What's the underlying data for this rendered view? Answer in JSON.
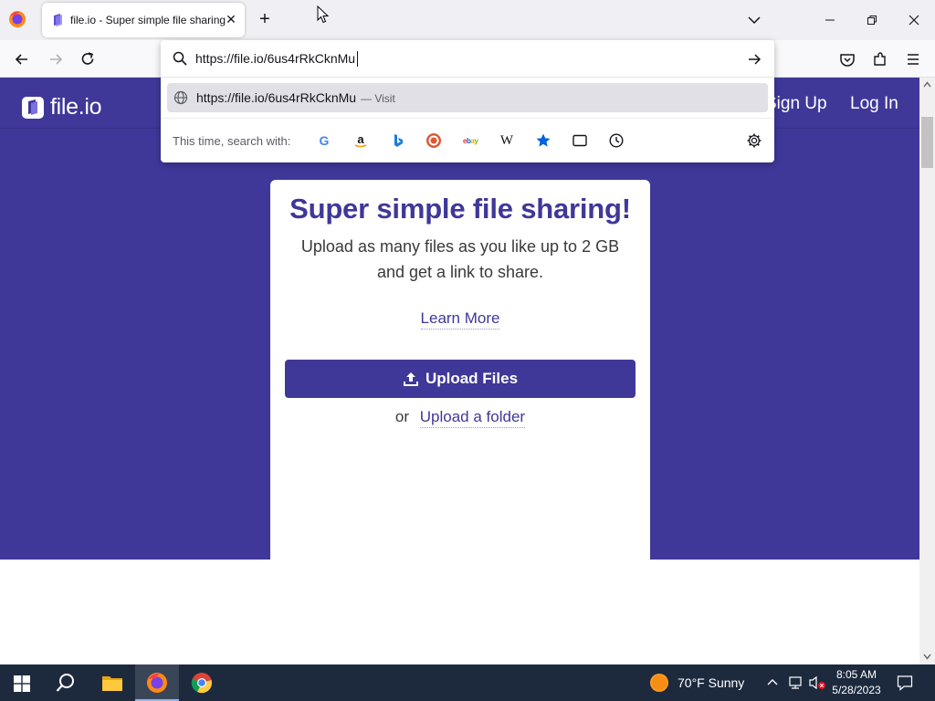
{
  "browser": {
    "tab_title": "file.io - Super simple file sharing",
    "url_value": "https://file.io/6us4rRkCknMu",
    "suggestion": {
      "url": "https://file.io/6us4rRkCknMu",
      "action": "— Visit"
    },
    "search_with_label": "This time, search with:",
    "search_engines": [
      "Google",
      "Amazon",
      "Bing",
      "DuckDuckGo",
      "eBay",
      "Wikipedia",
      "Bookmarks",
      "Tabs",
      "History"
    ]
  },
  "site": {
    "logo_text": "file.io",
    "nav": {
      "signup": "Sign Up",
      "login": "Log In"
    },
    "card": {
      "title": "Super simple file sharing!",
      "description": "Upload as many files as you like up to 2 GB and get a link to share.",
      "learn_more": "Learn More",
      "upload_button": "Upload Files",
      "or_text": "or",
      "upload_folder": "Upload a folder"
    }
  },
  "taskbar": {
    "weather": "70°F  Sunny",
    "time": "8:05 AM",
    "date": "5/28/2023"
  },
  "colors": {
    "brand": "#3f3899",
    "taskbar": "#1d2a3e"
  }
}
